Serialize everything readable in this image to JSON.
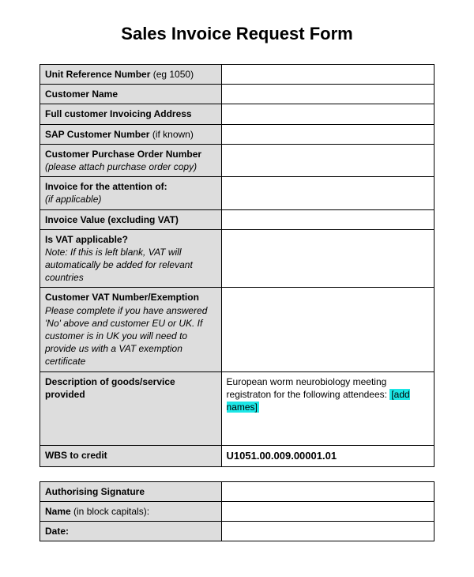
{
  "title": "Sales Invoice Request Form",
  "rows": {
    "unit_ref": {
      "bold": "Unit Reference Number",
      "hint": " (eg 1050)"
    },
    "customer_name": {
      "bold": "Customer Name"
    },
    "invoicing_address": {
      "pre": "Full customer ",
      "bold": "Invoicing Address"
    },
    "sap_number": {
      "bold": "SAP Customer Number",
      "hint": " (if known)"
    },
    "po_number": {
      "bold": "Customer Purchase Order Number",
      "note": "(please attach purchase order copy)"
    },
    "attention": {
      "bold": "Invoice for the attention of:",
      "note": "(if applicable)"
    },
    "invoice_value": {
      "bold": "Invoice Value (excluding VAT)"
    },
    "vat_applicable": {
      "bold": "Is VAT applicable?",
      "note": "Note: If this is left blank, VAT will automatically be added for relevant countries"
    },
    "vat_number": {
      "bold": "Customer VAT Number/Exemption",
      "note": "Please complete if you have answered 'No' above and customer EU or UK.  If customer is in UK you will need to provide us with a VAT exemption certificate"
    },
    "description": {
      "bold": "Description of goods/service provided"
    },
    "description_value_pre": "European worm neurobiology meeting registraton for the following attendees: ",
    "description_value_highlight": "[add names]",
    "wbs": {
      "bold": "WBS to credit"
    },
    "wbs_value": "U1051.00.009.00001.01"
  },
  "sig": {
    "authorising": "Authorising Signature",
    "name_bold": "Name",
    "name_hint": " (in block capitals):",
    "date": "Date:"
  }
}
